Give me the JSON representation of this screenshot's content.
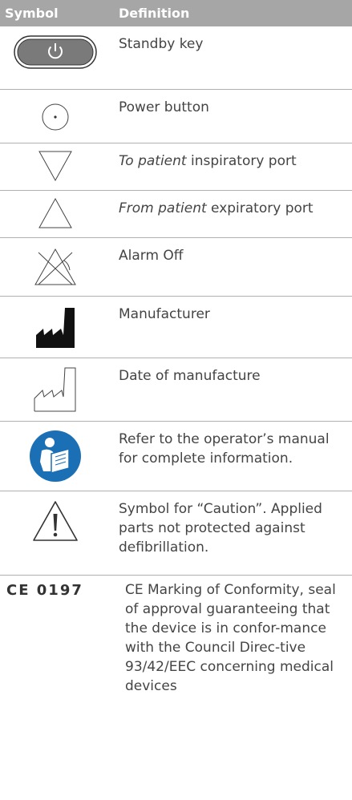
{
  "header": {
    "symbol": "Symbol",
    "definition": "Definition"
  },
  "rows": [
    {
      "icon": "standby-key-icon",
      "text": "Standby key"
    },
    {
      "icon": "power-button-icon",
      "text": "Power button"
    },
    {
      "icon": "to-patient-port-icon",
      "italic": "To patient",
      "text": " inspiratory port"
    },
    {
      "icon": "from-patient-port-icon",
      "italic": "From patient",
      "text": " expiratory port"
    },
    {
      "icon": "alarm-off-icon",
      "text": "Alarm Off"
    },
    {
      "icon": "manufacturer-icon",
      "text": "Manufacturer"
    },
    {
      "icon": "date-of-manufacture-icon",
      "text": "Date of manufacture"
    },
    {
      "icon": "operator-manual-icon",
      "text": "Refer to the operator’s manual for complete information."
    },
    {
      "icon": "caution-icon",
      "text": "Symbol for “Caution”. Applied parts not protected against defibrillation."
    },
    {
      "icon": "ce-mark-icon",
      "mark": "CE 0197",
      "text": "CE Marking of Conformity, seal of approval guaranteeing that the device is in confor-mance with the Council Direc-tive 93/42/EEC concerning medical devices"
    }
  ]
}
